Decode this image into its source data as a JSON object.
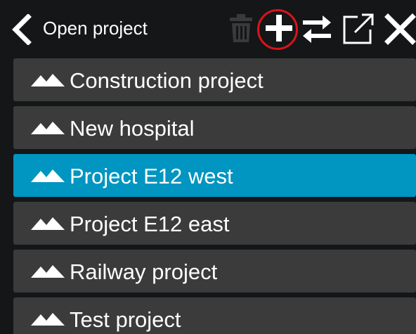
{
  "header": {
    "title": "Open project",
    "back_icon": "chevron-left-icon",
    "actions": [
      {
        "name": "trash-icon",
        "state": "disabled"
      },
      {
        "name": "plus-icon",
        "state": "highlighted"
      },
      {
        "name": "swap-icon",
        "state": "enabled"
      },
      {
        "name": "external-link-icon",
        "state": "enabled"
      },
      {
        "name": "close-icon",
        "state": "enabled"
      }
    ]
  },
  "projects": [
    {
      "label": "Construction project",
      "icon": "mountain-icon",
      "selected": false
    },
    {
      "label": "New hospital",
      "icon": "mountain-icon",
      "selected": false
    },
    {
      "label": "Project E12 west",
      "icon": "mountain-icon",
      "selected": true
    },
    {
      "label": "Project E12 east",
      "icon": "mountain-icon",
      "selected": false
    },
    {
      "label": "Railway project",
      "icon": "mountain-icon",
      "selected": false
    },
    {
      "label": "Test project",
      "icon": "mountain-icon",
      "selected": false
    }
  ],
  "colors": {
    "background": "#141618",
    "item": "#3b3b3b",
    "selected": "#0195c1",
    "highlight_circle": "#d8141c",
    "disabled_icon": "#3a3a3a",
    "text": "#ffffff"
  }
}
